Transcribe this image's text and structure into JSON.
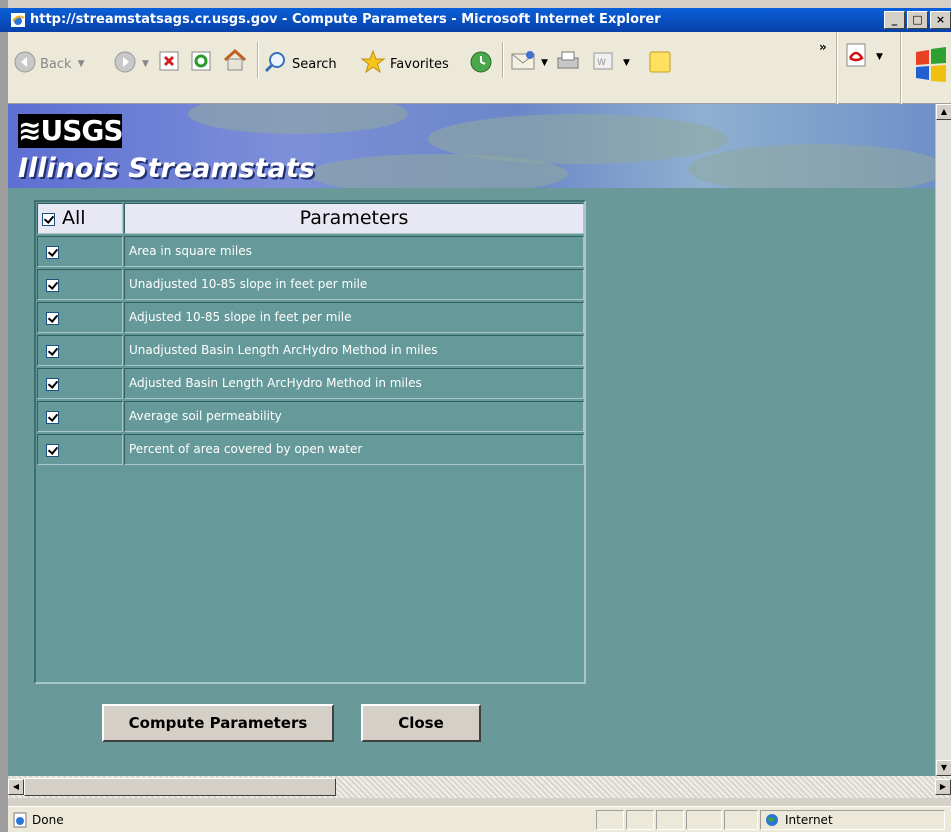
{
  "window": {
    "title": "http://streamstatsags.cr.usgs.gov - Compute Parameters - Microsoft Internet Explorer",
    "controls": [
      "_",
      "□",
      "×"
    ]
  },
  "toolbar": {
    "back_label": "Back",
    "search_label": "Search",
    "favorites_label": "Favorites",
    "overflow_label": "»"
  },
  "banner": {
    "logo_text": "≋USGS",
    "title": "Illinois Streamstats"
  },
  "table": {
    "all_label": "All",
    "header": "Parameters",
    "rows": [
      {
        "label": "Area in square miles",
        "checked": true
      },
      {
        "label": "Unadjusted 10-85 slope in feet per mile",
        "checked": true
      },
      {
        "label": "Adjusted 10-85 slope in feet per mile",
        "checked": true
      },
      {
        "label": "Unadjusted Basin Length ArcHydro Method in miles",
        "checked": true
      },
      {
        "label": "Adjusted Basin Length ArcHydro Method in miles",
        "checked": true
      },
      {
        "label": "Average soil permeability",
        "checked": true
      },
      {
        "label": "Percent of area covered by open water",
        "checked": true
      }
    ]
  },
  "buttons": {
    "compute": "Compute Parameters",
    "close": "Close"
  },
  "status": {
    "left": "Done",
    "zone": "Internet"
  },
  "colors": {
    "page_bg": "#669999",
    "title_bar": "#0841a8",
    "header_cell": "#e8e8f4"
  }
}
